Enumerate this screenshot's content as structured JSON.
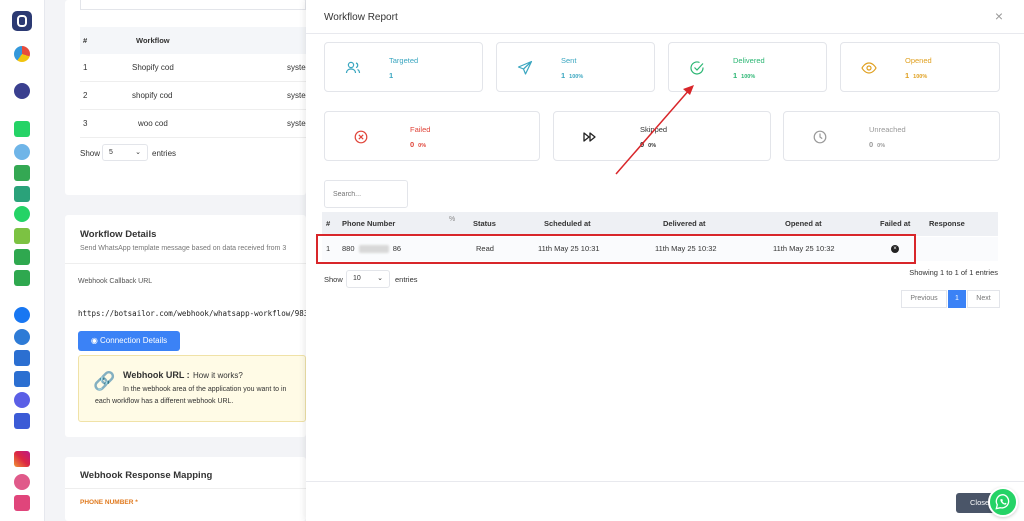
{
  "sidebar": {
    "icons": [
      "bot-logo-icon",
      "gauge-icon",
      "messenger-icon",
      "whatsapp-icon",
      "robot-icon",
      "sheet-icon",
      "whatsapp-icon",
      "puzzle-icon",
      "bag-icon",
      "megaphone-icon",
      "facebook-icon",
      "robot-icon",
      "cursor-icon",
      "paper-plane-icon",
      "messenger-icon",
      "flag-icon",
      "instagram-icon",
      "robot-icon",
      "phone-icon"
    ]
  },
  "background": {
    "workflow_table": {
      "headers": [
        "#",
        "Workflow"
      ],
      "rows": [
        {
          "num": "1",
          "name": "Shopify cod",
          "extra": "syster"
        },
        {
          "num": "2",
          "name": "shopify cod",
          "extra": "syster"
        },
        {
          "num": "3",
          "name": "woo cod",
          "extra": "syster"
        }
      ],
      "show_label": "Show",
      "show_value": "5",
      "entries_label": "entries"
    },
    "workflow_details": {
      "title": "Workflow Details",
      "subtitle": "Send WhatsApp template message based on data received from 3",
      "callback_label": "Webhook Callback URL",
      "callback_url": "https://botsailor.com/webhook/whatsapp-workflow/983",
      "connection_button": "Connection Details",
      "note_title": "Webhook URL :",
      "note_title_suffix": "How it works?",
      "note_line1": "In the webhook area of the application you want to in",
      "note_line2": "each workflow has a different webhook URL."
    },
    "mapping": {
      "title": "Webhook Response Mapping",
      "phone_label": "PHONE NUMBER *"
    }
  },
  "modal": {
    "title": "Workflow Report",
    "stats_row1": [
      {
        "label": "Targeted",
        "count": "1",
        "pct": "",
        "color": "#3aa6c0",
        "icon": "users-icon"
      },
      {
        "label": "Sent",
        "count": "1",
        "pct": "100%",
        "color": "#3aa6c0",
        "icon": "paper-plane-icon"
      },
      {
        "label": "Delivered",
        "count": "1",
        "pct": "100%",
        "color": "#2bb673",
        "icon": "check-circle-icon"
      },
      {
        "label": "Opened",
        "count": "1",
        "pct": "100%",
        "color": "#e0a020",
        "icon": "eye-icon"
      }
    ],
    "stats_row2": [
      {
        "label": "Failed",
        "count": "0",
        "pct": "0%",
        "color": "#e0453a",
        "icon": "x-circle-icon"
      },
      {
        "label": "Skipped",
        "count": "0",
        "pct": "0%",
        "color": "#333333",
        "icon": "fast-forward-icon"
      },
      {
        "label": "Unreached",
        "count": "0",
        "pct": "0%",
        "color": "#999999",
        "icon": "clock-icon"
      }
    ],
    "percent_glyph": "%",
    "search_placeholder": "Search...",
    "table": {
      "headers": [
        "#",
        "Phone Number",
        "Status",
        "Scheduled at",
        "Delivered at",
        "Opened at",
        "Failed at",
        "Response"
      ],
      "rows": [
        {
          "num": "1",
          "phone_prefix": "880",
          "phone_suffix": "86",
          "status": "Read",
          "scheduled": "11th May 25 10:31",
          "delivered": "11th May 25 10:32",
          "opened": "11th May 25 10:32"
        }
      ]
    },
    "show_label": "Show",
    "show_value": "10",
    "entries_label": "entries",
    "info": "Showing 1 to 1 of 1 entries",
    "pager": {
      "previous": "Previous",
      "page": "1",
      "next": "Next"
    },
    "close_button": "Close"
  },
  "colors": {
    "accent": "#3b82f6",
    "highlight": "#d8262a",
    "arrow": "#d8262a"
  }
}
